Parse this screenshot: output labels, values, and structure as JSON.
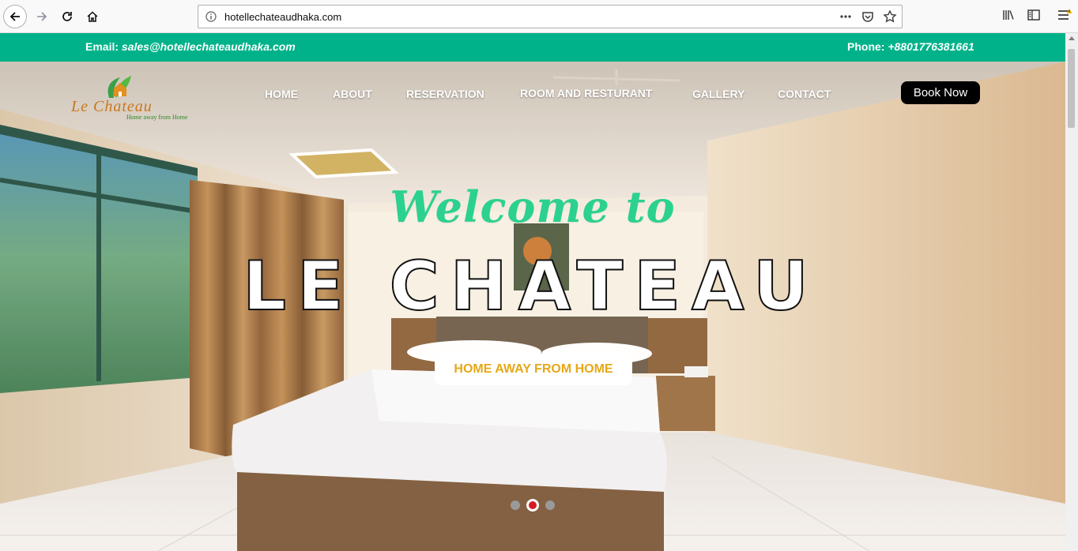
{
  "browser": {
    "url": "hotellechateaudhaka.com",
    "icons": [
      "back-arrow-icon",
      "forward-arrow-icon",
      "reload-icon",
      "home-icon",
      "info-icon",
      "more-dots-icon",
      "pocket-icon",
      "bookmark-star-icon",
      "library-icon",
      "sidebar-icon",
      "menu-icon",
      "warning-icon"
    ]
  },
  "topbar": {
    "email_label": "Email:",
    "email_value": "sales@hotellechateaudhaka.com",
    "phone_label": "Phone:",
    "phone_value": "+8801776381661",
    "color": "#00b28a"
  },
  "logo": {
    "name": "Le Chateau",
    "tagline": "Home away from Home"
  },
  "nav": {
    "items": [
      {
        "label": "HOME"
      },
      {
        "label": "ABOUT"
      },
      {
        "label": "RESERVATION"
      },
      {
        "label": "ROOM AND RESTURANT"
      },
      {
        "label": "GALLERY"
      },
      {
        "label": "CONTACT"
      }
    ],
    "book_now": "Book Now"
  },
  "hero": {
    "welcome": "Welcome to",
    "title": "LE CHATEAU",
    "tagline": "HOME AWAY FROM HOME",
    "slides": 3,
    "active_slide": 2,
    "accent_color": "#2bd18f",
    "tagline_color": "#e6a817"
  }
}
